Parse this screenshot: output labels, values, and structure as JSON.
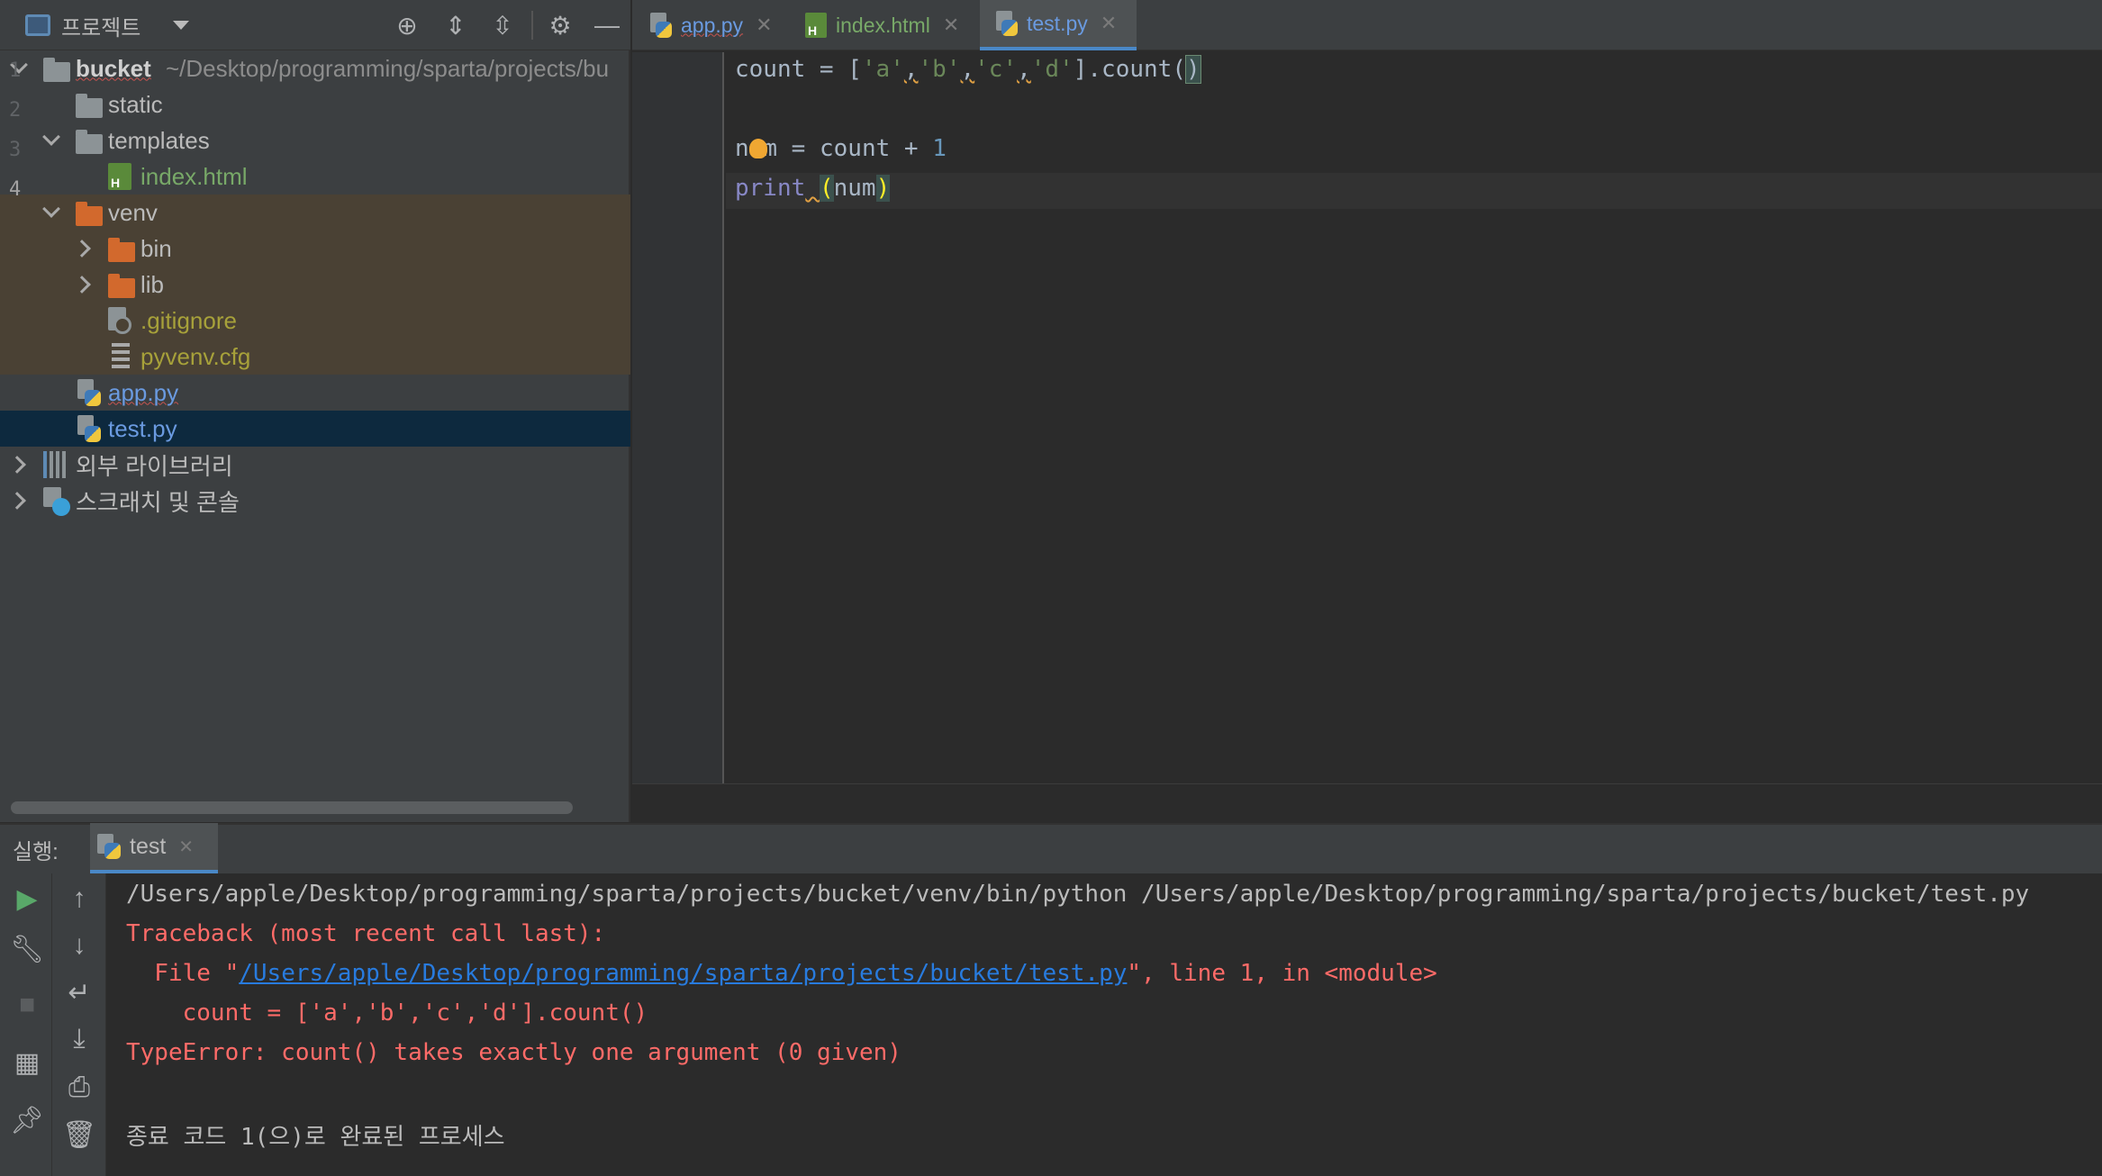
{
  "project_panel": {
    "title": "프로젝트",
    "toolbar_icons": [
      "locate-icon",
      "expand-all-icon",
      "collapse-all-icon",
      "gear-icon",
      "minimize-icon"
    ],
    "tree": {
      "root_name": "bucket",
      "root_path": "~/Desktop/programming/sparta/projects/bu",
      "static": "static",
      "templates": "templates",
      "index_html": "index.html",
      "venv": "venv",
      "bin": "bin",
      "lib": "lib",
      "gitignore": ".gitignore",
      "pyvenv": "pyvenv.cfg",
      "app_py": "app.py",
      "test_py": "test.py",
      "external_libs": "외부 라이브러리",
      "scratches": "스크래치 및 콘솔"
    }
  },
  "editor": {
    "tabs": [
      {
        "label": "app.py",
        "icon": "python-file-icon"
      },
      {
        "label": "index.html",
        "icon": "html-file-icon"
      },
      {
        "label": "test.py",
        "icon": "python-file-icon",
        "active": true
      }
    ],
    "line_numbers": [
      "1",
      "2",
      "3",
      "4"
    ],
    "code": {
      "line1": {
        "count": "count",
        "eq": " = ",
        "open": "[",
        "a": "'a'",
        "comma1": ",",
        "b": "'b'",
        "comma2": ",",
        "c": "'c'",
        "comma3": ",",
        "d": "'d'",
        "close": "].count(",
        "rparen": ")"
      },
      "line3": {
        "n": "n",
        "um": "um",
        "rest": " = count + ",
        "one": "1"
      },
      "line4": {
        "print": "print",
        "space": " ",
        "lparen": "(",
        "arg": "num",
        "rparen": ")"
      }
    }
  },
  "run_window": {
    "label": "실행:",
    "tab_name": "test",
    "console": {
      "command": "/Users/apple/Desktop/programming/sparta/projects/bucket/venv/bin/python /Users/apple/Desktop/programming/sparta/projects/bucket/test.py",
      "traceback": "Traceback (most recent call last):",
      "file_prefix": "  File \"",
      "file_link": "/Users/apple/Desktop/programming/sparta/projects/bucket/test.py",
      "file_suffix": "\", line 1, in <module>",
      "code_line": "    count = ['a','b','c','d'].count()",
      "error": "TypeError: count() takes exactly one argument (0 given)",
      "finished": "종료 코드 1(으)로 완료된 프로세스"
    }
  },
  "colors": {
    "accent": "#4a88c7",
    "error": "#ff6b68",
    "link": "#287bde",
    "excluded_bg": "#4a4134",
    "selected_bg": "#0d293e"
  }
}
